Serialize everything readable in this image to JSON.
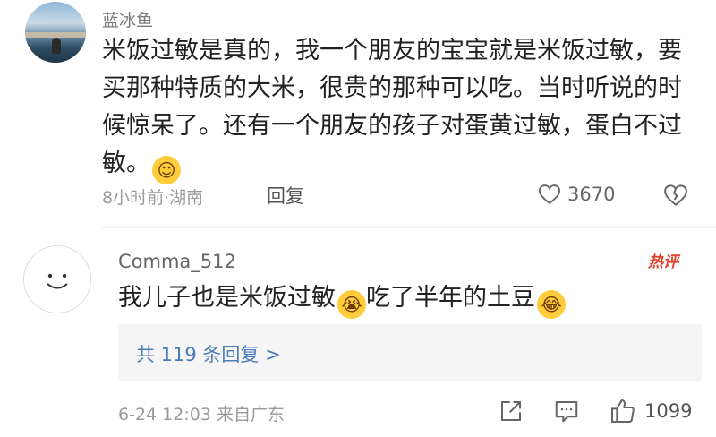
{
  "comment1": {
    "username": "蓝冰鱼",
    "body": "米饭过敏是真的，我一个朋友的宝宝就是米饭过敏，要买那种特质的大米，很贵的那种可以吃。当时听说的时候惊呆了。还有一个朋友的孩子对蛋黄过敏，蛋白不过敏。",
    "meta": "8小时前·湖南",
    "reply_label": "回复",
    "likes": "3670"
  },
  "comment2": {
    "username": "Comma_512",
    "hot_badge": "热评",
    "body_part1": "我儿子也是米饭过敏",
    "body_part2": "吃了半年的土豆",
    "replies_link": "共 119 条回复 >",
    "meta": "6-24 12:03 来自广东",
    "likes": "1099"
  },
  "icons": {
    "avatar1": "landscape-photo-avatar",
    "avatar2": "smiley-face-avatar",
    "emoji1": "rofl-emoji-icon",
    "emoji2": "crying-emoji-icon",
    "emoji3": "laughing-tears-emoji-icon"
  }
}
